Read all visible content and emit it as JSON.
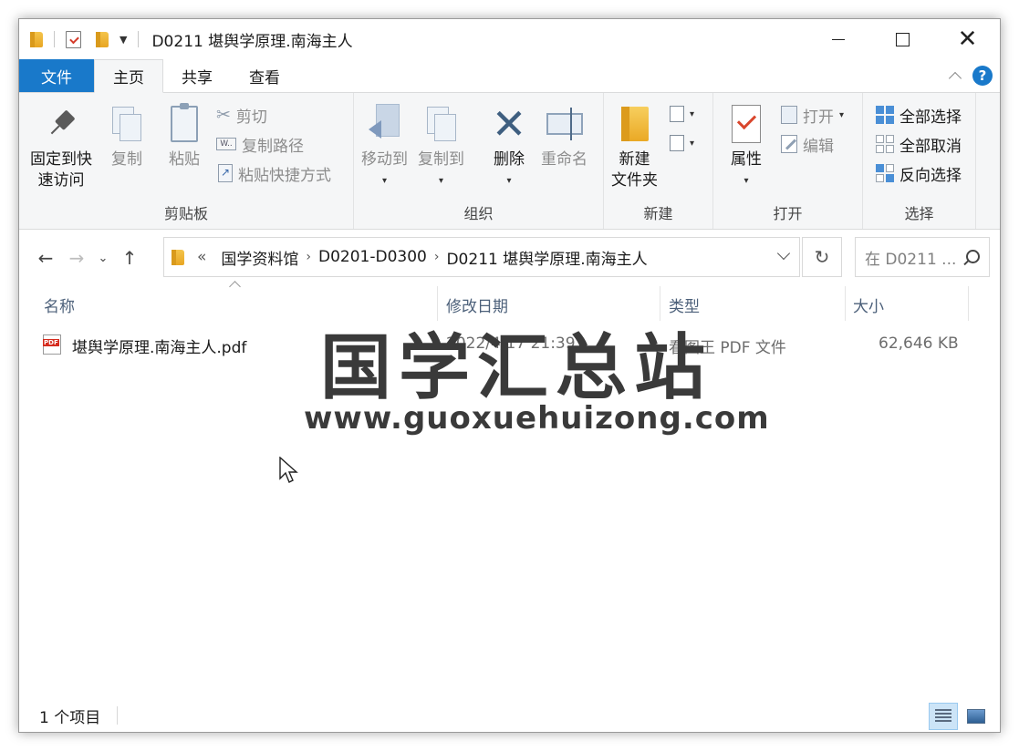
{
  "window": {
    "title": "D0211 堪舆学原理.南海主人"
  },
  "tabs": {
    "file": "文件",
    "home": "主页",
    "share": "共享",
    "view": "查看"
  },
  "ribbon": {
    "clipboard": {
      "label": "剪贴板",
      "pin": "固定到快\n速访问",
      "pin_line1": "固定到快",
      "pin_line2": "速访问",
      "copy": "复制",
      "paste": "粘贴",
      "cut": "剪切",
      "copy_path": "复制路径",
      "paste_shortcut": "粘贴快捷方式"
    },
    "organize": {
      "label": "组织",
      "move_to": "移动到",
      "copy_to": "复制到",
      "delete": "删除",
      "rename": "重命名"
    },
    "new": {
      "label": "新建",
      "new_folder_line1": "新建",
      "new_folder_line2": "文件夹"
    },
    "open": {
      "label": "打开",
      "properties": "属性",
      "open": "打开",
      "edit": "编辑"
    },
    "select": {
      "label": "选择",
      "select_all": "全部选择",
      "select_none": "全部取消",
      "invert": "反向选择"
    }
  },
  "address": {
    "overflow": "«",
    "crumbs": [
      "国学资料馆",
      "D0201-D0300",
      "D0211 堪舆学原理.南海主人"
    ],
    "search_placeholder": "在 D0211 ..."
  },
  "columns": {
    "name": "名称",
    "modified": "修改日期",
    "type": "类型",
    "size": "大小"
  },
  "files": [
    {
      "name": "堪舆学原理.南海主人.pdf",
      "modified": "2022/4/17 21:39",
      "type": "看图王 PDF 文件",
      "size": "62,646 KB"
    }
  ],
  "watermark": {
    "title": "国学汇总站",
    "url": "www.guoxuehuizong.com"
  },
  "status": {
    "count": "1 个项目"
  }
}
